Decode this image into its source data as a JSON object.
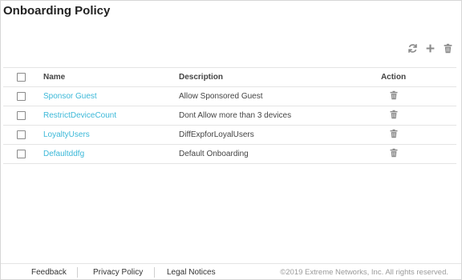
{
  "page": {
    "title": "Onboarding Policy"
  },
  "toolbar": {
    "icons": [
      "refresh-icon",
      "plus-icon",
      "trash-icon"
    ]
  },
  "table": {
    "headers": {
      "name": "Name",
      "description": "Description",
      "action": "Action"
    },
    "rows": [
      {
        "name": "Sponsor Guest",
        "description": "Allow Sponsored Guest"
      },
      {
        "name": "RestrictDeviceCount",
        "description": "Dont Allow more than 3 devices"
      },
      {
        "name": "LoyaltyUsers",
        "description": "DiffExpforLoyalUsers"
      },
      {
        "name": "Defaultddfg",
        "description": "Default Onboarding"
      }
    ]
  },
  "footer": {
    "feedback": "Feedback",
    "privacy": "Privacy Policy",
    "legal": "Legal Notices",
    "copyright": "©2019 Extreme Networks, Inc. All rights reserved."
  },
  "colors": {
    "link": "#3bb8d8",
    "icon": "#8a8a8a"
  }
}
